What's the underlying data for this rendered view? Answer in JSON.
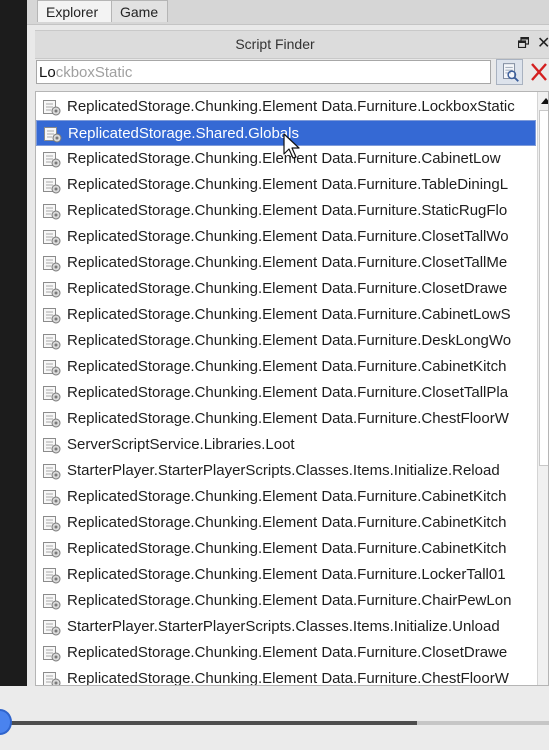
{
  "tabs": [
    {
      "label": "Explorer",
      "active": true
    },
    {
      "label": "Game",
      "active": false
    }
  ],
  "panel": {
    "title": "Script Finder",
    "dock_icon": "dock-window-icon",
    "close_icon": "close-icon"
  },
  "search": {
    "typed": "Lo",
    "suggestion": "ckboxStatic",
    "find_icon": "find-scripts-icon",
    "clear_icon": "clear-red-x-icon"
  },
  "results": [
    {
      "label": "ReplicatedStorage.Chunking.Element Data.Furniture.LockboxStatic",
      "selected": false
    },
    {
      "label": "ReplicatedStorage.Shared.Globals",
      "selected": true
    },
    {
      "label": "ReplicatedStorage.Chunking.Element Data.Furniture.CabinetLow",
      "selected": false
    },
    {
      "label": "ReplicatedStorage.Chunking.Element Data.Furniture.TableDiningL",
      "selected": false
    },
    {
      "label": "ReplicatedStorage.Chunking.Element Data.Furniture.StaticRugFlo",
      "selected": false
    },
    {
      "label": "ReplicatedStorage.Chunking.Element Data.Furniture.ClosetTallWo",
      "selected": false
    },
    {
      "label": "ReplicatedStorage.Chunking.Element Data.Furniture.ClosetTallMe",
      "selected": false
    },
    {
      "label": "ReplicatedStorage.Chunking.Element Data.Furniture.ClosetDrawe",
      "selected": false
    },
    {
      "label": "ReplicatedStorage.Chunking.Element Data.Furniture.CabinetLowS",
      "selected": false
    },
    {
      "label": "ReplicatedStorage.Chunking.Element Data.Furniture.DeskLongWo",
      "selected": false
    },
    {
      "label": "ReplicatedStorage.Chunking.Element Data.Furniture.CabinetKitch",
      "selected": false
    },
    {
      "label": "ReplicatedStorage.Chunking.Element Data.Furniture.ClosetTallPla",
      "selected": false
    },
    {
      "label": "ReplicatedStorage.Chunking.Element Data.Furniture.ChestFloorW",
      "selected": false
    },
    {
      "label": "ServerScriptService.Libraries.Loot",
      "selected": false
    },
    {
      "label": "StarterPlayer.StarterPlayerScripts.Classes.Items.Initialize.Reload",
      "selected": false
    },
    {
      "label": "ReplicatedStorage.Chunking.Element Data.Furniture.CabinetKitch",
      "selected": false
    },
    {
      "label": "ReplicatedStorage.Chunking.Element Data.Furniture.CabinetKitch",
      "selected": false
    },
    {
      "label": "ReplicatedStorage.Chunking.Element Data.Furniture.CabinetKitch",
      "selected": false
    },
    {
      "label": "ReplicatedStorage.Chunking.Element Data.Furniture.LockerTall01",
      "selected": false
    },
    {
      "label": "ReplicatedStorage.Chunking.Element Data.Furniture.ChairPewLon",
      "selected": false
    },
    {
      "label": "StarterPlayer.StarterPlayerScripts.Classes.Items.Initialize.Unload",
      "selected": false
    },
    {
      "label": "ReplicatedStorage.Chunking.Element Data.Furniture.ClosetDrawe",
      "selected": false
    },
    {
      "label": "ReplicatedStorage.Chunking.Element Data.Furniture.ChestFloorW",
      "selected": false
    }
  ],
  "result_icon": "script-file-icon",
  "scrollbar": {
    "up_icon": "scroll-up-arrow-icon"
  },
  "timeline": {
    "progress": 0.76,
    "knob_icon": "slider-knob"
  },
  "colors": {
    "selection": "#3569d4",
    "accent": "#4a83ee",
    "clear_red": "#d42020"
  }
}
